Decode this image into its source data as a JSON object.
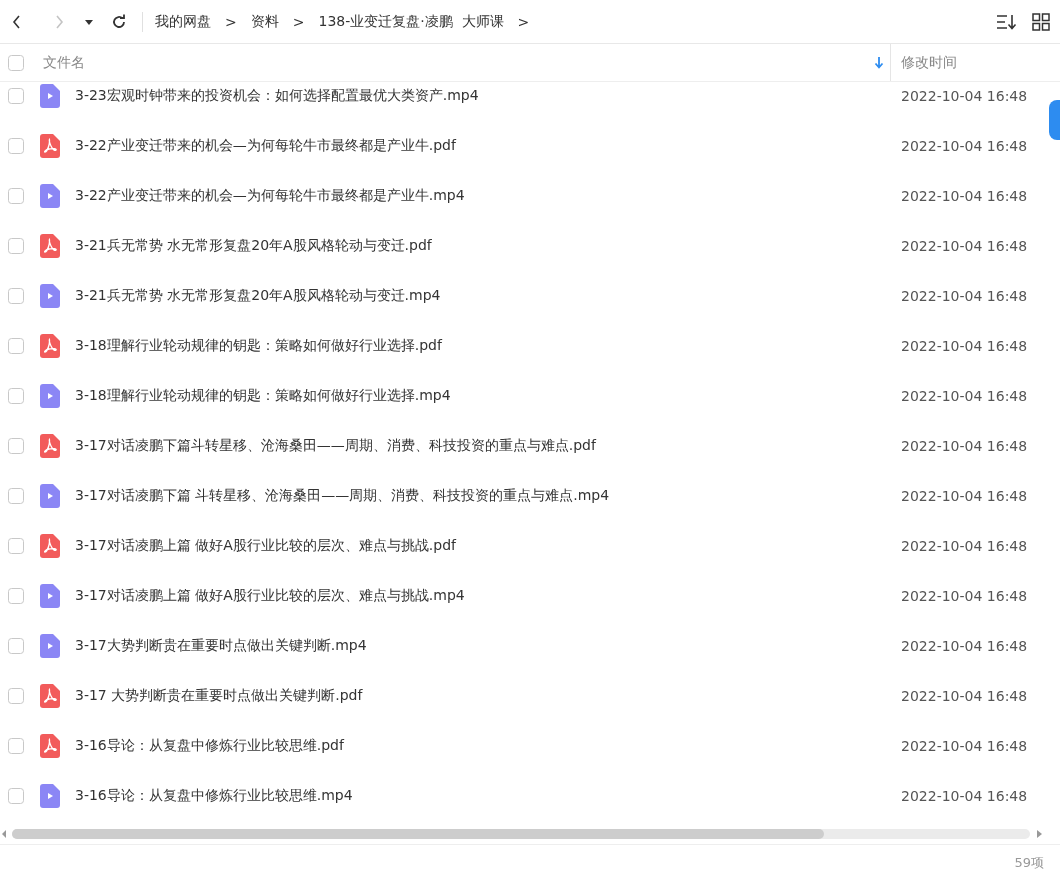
{
  "toolbar": {
    "nav": [
      {
        "kind": "back",
        "disabled": false
      },
      {
        "kind": "forward",
        "disabled": true
      },
      {
        "kind": "history",
        "disabled": false
      },
      {
        "kind": "refresh",
        "disabled": false
      }
    ],
    "breadcrumb": [
      {
        "label": "我的网盘",
        "separator": ">"
      },
      {
        "label": "资料",
        "separator": ">"
      },
      {
        "label": "138-业变迁复盘·凌鹏  大师课",
        "separator": ">"
      }
    ]
  },
  "table": {
    "select_all": {
      "checked": false
    },
    "columns": [
      {
        "label": "文件名",
        "sorted": true
      },
      {
        "label": "修改时间",
        "sorted": false
      }
    ],
    "rows": [
      {
        "kind": "video",
        "name": "3-23宏观时钟带来的投资机会：如何选择配置最优大类资产.mp4",
        "modified": "2022-10-04 16:48",
        "checked": false
      },
      {
        "kind": "pdf",
        "name": "3-22产业变迁带来的机会—为何每轮牛市最终都是产业牛.pdf",
        "modified": "2022-10-04 16:48",
        "checked": false
      },
      {
        "kind": "video",
        "name": "3-22产业变迁带来的机会—为何每轮牛市最终都是产业牛.mp4",
        "modified": "2022-10-04 16:48",
        "checked": false
      },
      {
        "kind": "pdf",
        "name": "3-21兵无常势 水无常形复盘20年A股风格轮动与变迁.pdf",
        "modified": "2022-10-04 16:48",
        "checked": false
      },
      {
        "kind": "video",
        "name": "3-21兵无常势 水无常形复盘20年A股风格轮动与变迁.mp4",
        "modified": "2022-10-04 16:48",
        "checked": false
      },
      {
        "kind": "pdf",
        "name": "3-18理解行业轮动规律的钥匙：策略如何做好行业选择.pdf",
        "modified": "2022-10-04 16:48",
        "checked": false
      },
      {
        "kind": "video",
        "name": "3-18理解行业轮动规律的钥匙：策略如何做好行业选择.mp4",
        "modified": "2022-10-04 16:48",
        "checked": false
      },
      {
        "kind": "pdf",
        "name": "3-17对话凌鹏下篇斗转星移、沧海桑田——周期、消费、科技投资的重点与难点.pdf",
        "modified": "2022-10-04 16:48",
        "checked": false
      },
      {
        "kind": "video",
        "name": "3-17对话凌鹏下篇 斗转星移、沧海桑田——周期、消费、科技投资的重点与难点.mp4",
        "modified": "2022-10-04 16:48",
        "checked": false
      },
      {
        "kind": "pdf",
        "name": "3-17对话凌鹏上篇 做好A股行业比较的层次、难点与挑战.pdf",
        "modified": "2022-10-04 16:48",
        "checked": false
      },
      {
        "kind": "video",
        "name": "3-17对话凌鹏上篇 做好A股行业比较的层次、难点与挑战.mp4",
        "modified": "2022-10-04 16:48",
        "checked": false
      },
      {
        "kind": "video",
        "name": "3-17大势判断贵在重要时点做出关键判断.mp4",
        "modified": "2022-10-04 16:48",
        "checked": false
      },
      {
        "kind": "pdf",
        "name": "3-17 大势判断贵在重要时点做出关键判断.pdf",
        "modified": "2022-10-04 16:48",
        "checked": false
      },
      {
        "kind": "pdf",
        "name": "3-16导论：从复盘中修炼行业比较思维.pdf",
        "modified": "2022-10-04 16:48",
        "checked": false
      },
      {
        "kind": "video",
        "name": "3-16导论：从复盘中修炼行业比较思维.mp4",
        "modified": "2022-10-04 16:48",
        "checked": false
      }
    ]
  },
  "status_bar": {
    "count": "59项"
  }
}
